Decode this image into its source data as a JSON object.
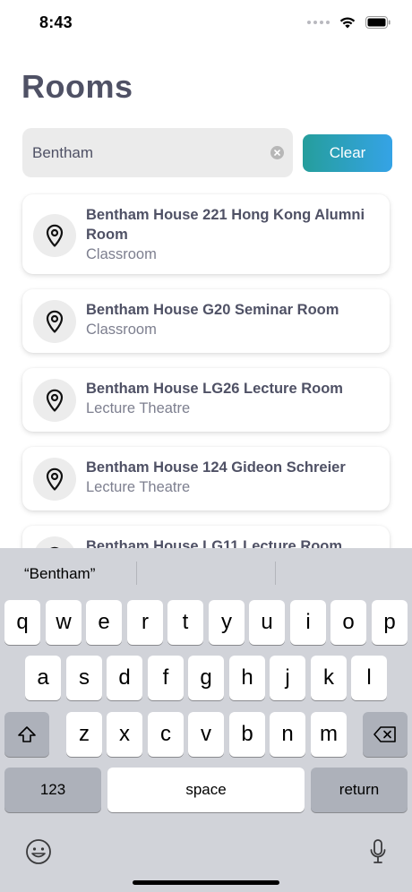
{
  "status_bar": {
    "time": "8:43"
  },
  "page": {
    "title": "Rooms"
  },
  "search": {
    "value": "Bentham",
    "clear_label": "Clear"
  },
  "results": [
    {
      "title": "Bentham House 221 Hong Kong Alumni Room",
      "type": "Classroom"
    },
    {
      "title": "Bentham House G20 Seminar Room",
      "type": "Classroom"
    },
    {
      "title": "Bentham House LG26 Lecture Room",
      "type": "Lecture Theatre"
    },
    {
      "title": "Bentham House 124 Gideon Schreier",
      "type": "Lecture Theatre"
    },
    {
      "title": "Bentham House LG11 Lecture Room",
      "type": ""
    }
  ],
  "keyboard": {
    "suggestion": "“Bentham”",
    "row1": [
      "q",
      "w",
      "e",
      "r",
      "t",
      "y",
      "u",
      "i",
      "o",
      "p"
    ],
    "row2": [
      "a",
      "s",
      "d",
      "f",
      "g",
      "h",
      "j",
      "k",
      "l"
    ],
    "row3": [
      "z",
      "x",
      "c",
      "v",
      "b",
      "n",
      "m"
    ],
    "numbers_label": "123",
    "space_label": "space",
    "return_label": "return"
  },
  "icons": {
    "wifi": "wifi-icon",
    "battery": "battery-icon",
    "pin": "location-pin-icon",
    "shift": "shift-icon",
    "delete": "delete-icon",
    "emoji": "emoji-icon",
    "mic": "microphone-icon"
  },
  "colors": {
    "accent_start": "#259e9c",
    "accent_end": "#35a3e6",
    "title": "#4f5165"
  }
}
